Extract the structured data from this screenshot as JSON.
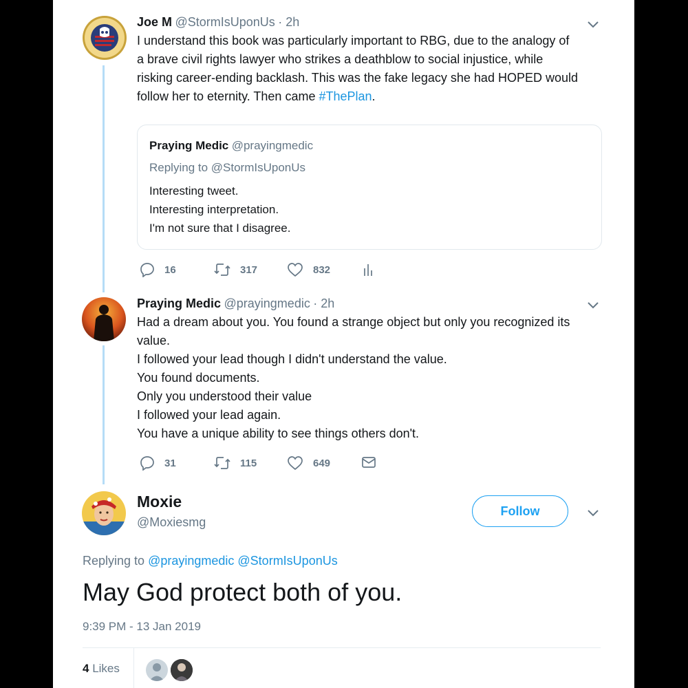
{
  "tweet1": {
    "name": "Joe M",
    "handle": "@StormIsUponUs",
    "time": "· 2h",
    "lines": [
      "I understand this book was particularly important to RBG, due to the analogy of",
      "a brave civil rights lawyer who strikes a deathblow to social injustice, while",
      "risking career-ending backlash. This was the fake legacy she had HOPED would"
    ],
    "last_line_prefix": "follow her to eternity. Then came ",
    "hashtag": "#ThePlan",
    "last_line_suffix": ".",
    "avatar_top_text": "MADE IN THE USA",
    "avatar_bottom_text": "MADE IN THE USA",
    "quote": {
      "name": "Praying Medic",
      "handle": "@prayingmedic",
      "replying": "Replying to @StormIsUponUs",
      "lines": [
        "Interesting tweet.",
        "Interesting interpretation.",
        "I'm not sure that I disagree."
      ]
    },
    "replies": "16",
    "retweets": "317",
    "likes": "832"
  },
  "tweet2": {
    "name": "Praying Medic",
    "handle": "@prayingmedic",
    "time": "· 2h",
    "lines": [
      "Had a dream about you. You found a strange object but only you recognized its",
      "value.",
      "I followed your lead though I didn't understand the value.",
      "You found documents.",
      "Only you understood their value",
      "I followed your lead again.",
      "You have a unique ability to see things others don't."
    ],
    "replies": "31",
    "retweets": "115",
    "likes": "649"
  },
  "main": {
    "name": "Moxie",
    "handle": "@Moxiesmg",
    "follow_label": "Follow",
    "replying_prefix": "Replying to ",
    "replying_user1": "@prayingmedic",
    "replying_user2": "@StormIsUponUs",
    "text": "May God protect both of you.",
    "timestamp": "9:39 PM - 13 Jan 2019",
    "likes_count": "4",
    "likes_label": "Likes"
  },
  "colors": {
    "accent": "#1da1f2",
    "link": "#1b95e0",
    "thread_line": "#b5dcf7",
    "muted": "#657786"
  },
  "icons": [
    "reply-icon",
    "retweet-icon",
    "like-icon",
    "analytics-icon",
    "message-icon",
    "chevron-down-icon"
  ]
}
